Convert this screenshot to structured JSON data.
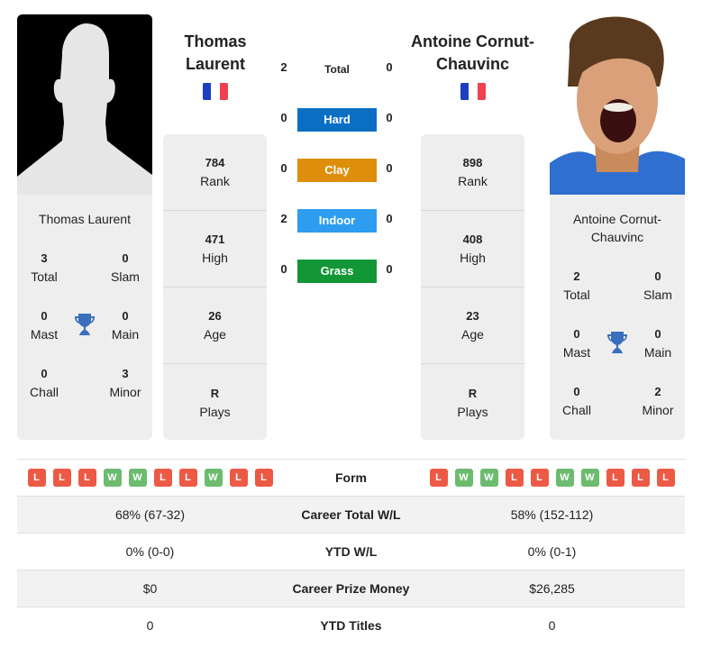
{
  "colors": {
    "hard": "#0a6fc2",
    "clay": "#dd8e0a",
    "indoor": "#2e9df0",
    "grass": "#129636",
    "win": "#6dbb6f",
    "loss": "#ec5a45",
    "card_bg": "#eeeeee",
    "trophy": "#3a6fbd"
  },
  "player1": {
    "name_line1": "Thomas",
    "name_line2": "Laurent",
    "full_name": "Thomas Laurent",
    "flag": "France",
    "titles": {
      "total": "3",
      "total_label": "Total",
      "slam": "0",
      "slam_label": "Slam",
      "mast": "0",
      "mast_label": "Mast",
      "main": "0",
      "main_label": "Main",
      "chall": "0",
      "chall_label": "Chall",
      "minor": "3",
      "minor_label": "Minor"
    },
    "stats": [
      {
        "value": "784",
        "label": "Rank"
      },
      {
        "value": "471",
        "label": "High"
      },
      {
        "value": "26",
        "label": "Age"
      },
      {
        "value": "R",
        "label": "Plays"
      }
    ],
    "form": [
      "L",
      "L",
      "L",
      "W",
      "W",
      "L",
      "L",
      "W",
      "L",
      "L"
    ]
  },
  "player2": {
    "name_line1": "Antoine Cornut-",
    "name_line2": "Chauvinc",
    "full_name_line1": "Antoine Cornut-",
    "full_name_line2": "Chauvinc",
    "flag": "France",
    "titles": {
      "total": "2",
      "total_label": "Total",
      "slam": "0",
      "slam_label": "Slam",
      "mast": "0",
      "mast_label": "Mast",
      "main": "0",
      "main_label": "Main",
      "chall": "0",
      "chall_label": "Chall",
      "minor": "2",
      "minor_label": "Minor"
    },
    "stats": [
      {
        "value": "898",
        "label": "Rank"
      },
      {
        "value": "408",
        "label": "High"
      },
      {
        "value": "23",
        "label": "Age"
      },
      {
        "value": "R",
        "label": "Plays"
      }
    ],
    "form": [
      "L",
      "W",
      "W",
      "L",
      "L",
      "W",
      "W",
      "L",
      "L",
      "L"
    ]
  },
  "h2h": {
    "total": {
      "label": "Total",
      "p1": "2",
      "p2": "0"
    },
    "surfaces": [
      {
        "label": "Hard",
        "p1": "0",
        "p2": "0"
      },
      {
        "label": "Clay",
        "p1": "0",
        "p2": "0"
      },
      {
        "label": "Indoor",
        "p1": "2",
        "p2": "0"
      },
      {
        "label": "Grass",
        "p1": "0",
        "p2": "0"
      }
    ]
  },
  "comparison": {
    "form_label": "Form",
    "rows": [
      {
        "label": "Career Total W/L",
        "p1": "68% (67-32)",
        "p2": "58% (152-112)"
      },
      {
        "label": "YTD W/L",
        "p1": "0% (0-0)",
        "p2": "0% (0-1)"
      },
      {
        "label": "Career Prize Money",
        "p1": "$0",
        "p2": "$26,285"
      },
      {
        "label": "YTD Titles",
        "p1": "0",
        "p2": "0"
      }
    ]
  }
}
